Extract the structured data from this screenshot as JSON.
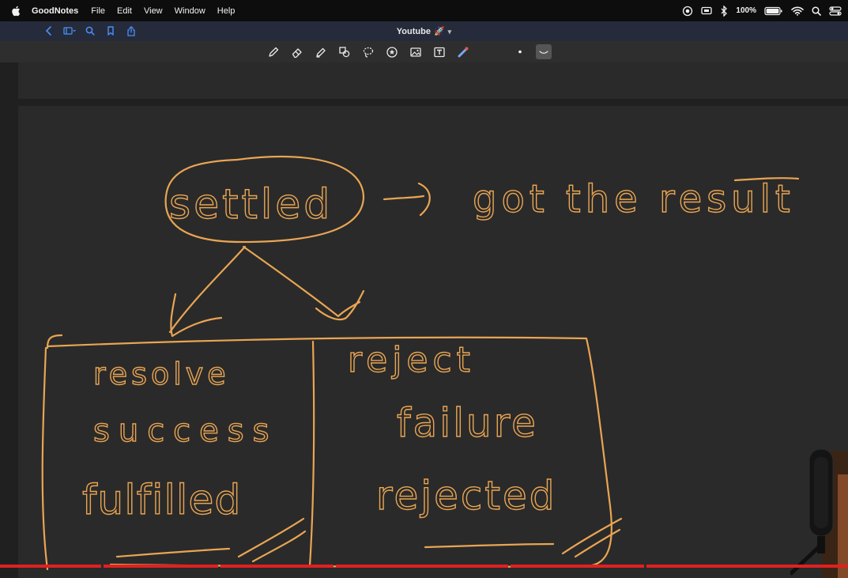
{
  "menubar": {
    "app_name": "GoodNotes",
    "items": [
      "File",
      "Edit",
      "View",
      "Window",
      "Help"
    ],
    "battery": "100%"
  },
  "titlebar": {
    "document_title": "Youtube",
    "title_emoji": "🚀"
  },
  "toolbar": {
    "tools": [
      "pen-tool",
      "eraser-tool",
      "highlighter-tool",
      "shapes-tool",
      "lasso-tool",
      "elements-tool",
      "image-tool",
      "text-tool",
      "laser-pointer-tool"
    ]
  },
  "notes": {
    "settled": "settled",
    "result": "got the result",
    "left_col": [
      "resolve",
      "success",
      "fulfilled"
    ],
    "right_col": [
      "reject",
      "failure",
      "rejected"
    ]
  },
  "colors": {
    "ink": "#e9a553",
    "progress": "#e02020"
  },
  "video": {
    "segments": 6
  }
}
